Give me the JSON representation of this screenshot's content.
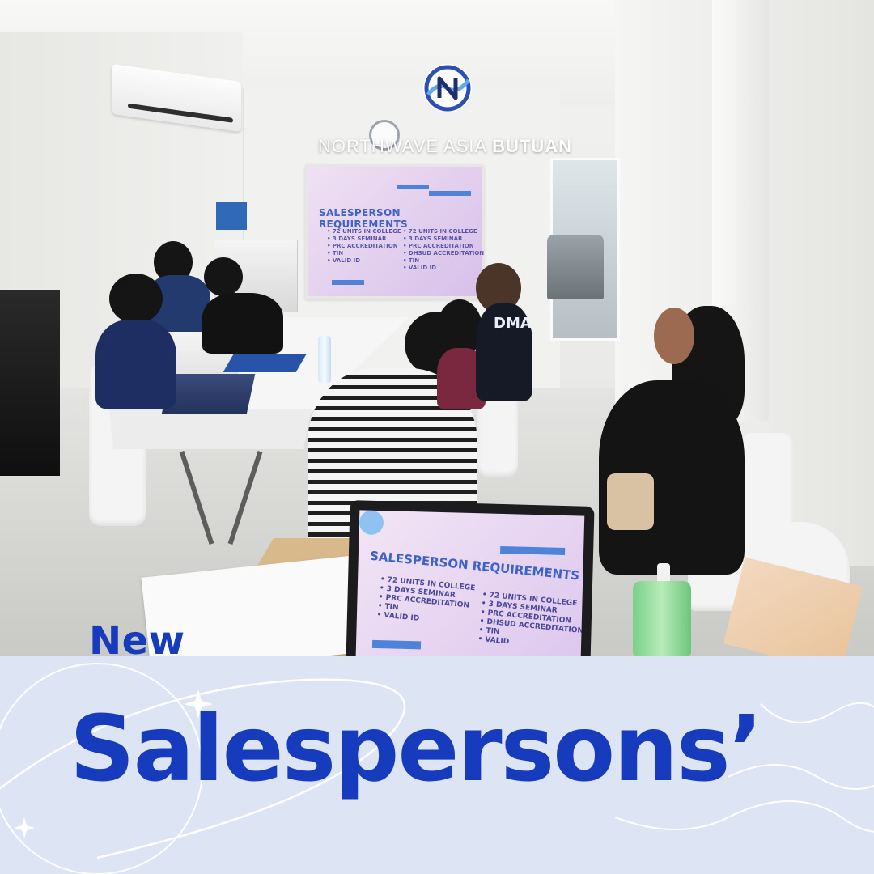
{
  "brand": {
    "name_light": "NORTHWAVE ASIA ",
    "name_bold": "BUTUAN",
    "logo_icon": "northwave-globe-logo"
  },
  "projected_slide": {
    "title": "SALESPERSON REQUIREMENTS",
    "left_list": "• 72 UNITS IN COLLEGE\n• 3 DAYS SEMINAR\n• PRC ACCREDITATION\n• TIN\n• VALID ID",
    "right_list": "• 72 UNITS IN COLLEGE\n• 3 DAYS SEMINAR\n• PRC ACCREDITATION\n• DHSUD ACCREDITATION\n• TIN\n• VALID ID"
  },
  "laptop_slide": {
    "title": "SALESPERSON REQUIREMENTS",
    "left_list": "• 72 UNITS IN COLLEGE\n• 3 DAYS SEMINAR\n• PRC ACCREDITATION\n• TIN\n• VALID ID",
    "right_list": "• 72 UNITS IN COLLEGE\n• 3 DAYS SEMINAR\n• PRC ACCREDITATION\n• DHSUD ACCREDITATION\n• TIN\n• VALID"
  },
  "shirt_text": "DMA",
  "headline": {
    "line1": "New",
    "line2": "Salespersons’"
  },
  "colors": {
    "headline": "#173bbd",
    "banner_bg": "#dde4f3",
    "slide_accent": "#3e62c9"
  }
}
